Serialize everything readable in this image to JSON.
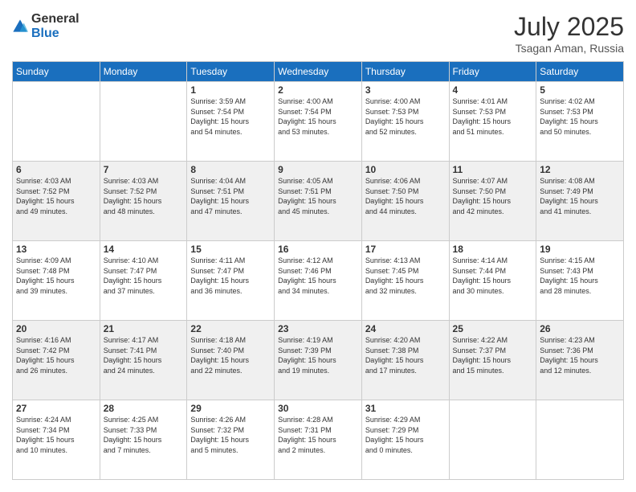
{
  "logo": {
    "general": "General",
    "blue": "Blue"
  },
  "header": {
    "month": "July 2025",
    "location": "Tsagan Aman, Russia"
  },
  "weekdays": [
    "Sunday",
    "Monday",
    "Tuesday",
    "Wednesday",
    "Thursday",
    "Friday",
    "Saturday"
  ],
  "weeks": [
    [
      {
        "day": "",
        "info": ""
      },
      {
        "day": "",
        "info": ""
      },
      {
        "day": "1",
        "info": "Sunrise: 3:59 AM\nSunset: 7:54 PM\nDaylight: 15 hours\nand 54 minutes."
      },
      {
        "day": "2",
        "info": "Sunrise: 4:00 AM\nSunset: 7:54 PM\nDaylight: 15 hours\nand 53 minutes."
      },
      {
        "day": "3",
        "info": "Sunrise: 4:00 AM\nSunset: 7:53 PM\nDaylight: 15 hours\nand 52 minutes."
      },
      {
        "day": "4",
        "info": "Sunrise: 4:01 AM\nSunset: 7:53 PM\nDaylight: 15 hours\nand 51 minutes."
      },
      {
        "day": "5",
        "info": "Sunrise: 4:02 AM\nSunset: 7:53 PM\nDaylight: 15 hours\nand 50 minutes."
      }
    ],
    [
      {
        "day": "6",
        "info": "Sunrise: 4:03 AM\nSunset: 7:52 PM\nDaylight: 15 hours\nand 49 minutes."
      },
      {
        "day": "7",
        "info": "Sunrise: 4:03 AM\nSunset: 7:52 PM\nDaylight: 15 hours\nand 48 minutes."
      },
      {
        "day": "8",
        "info": "Sunrise: 4:04 AM\nSunset: 7:51 PM\nDaylight: 15 hours\nand 47 minutes."
      },
      {
        "day": "9",
        "info": "Sunrise: 4:05 AM\nSunset: 7:51 PM\nDaylight: 15 hours\nand 45 minutes."
      },
      {
        "day": "10",
        "info": "Sunrise: 4:06 AM\nSunset: 7:50 PM\nDaylight: 15 hours\nand 44 minutes."
      },
      {
        "day": "11",
        "info": "Sunrise: 4:07 AM\nSunset: 7:50 PM\nDaylight: 15 hours\nand 42 minutes."
      },
      {
        "day": "12",
        "info": "Sunrise: 4:08 AM\nSunset: 7:49 PM\nDaylight: 15 hours\nand 41 minutes."
      }
    ],
    [
      {
        "day": "13",
        "info": "Sunrise: 4:09 AM\nSunset: 7:48 PM\nDaylight: 15 hours\nand 39 minutes."
      },
      {
        "day": "14",
        "info": "Sunrise: 4:10 AM\nSunset: 7:47 PM\nDaylight: 15 hours\nand 37 minutes."
      },
      {
        "day": "15",
        "info": "Sunrise: 4:11 AM\nSunset: 7:47 PM\nDaylight: 15 hours\nand 36 minutes."
      },
      {
        "day": "16",
        "info": "Sunrise: 4:12 AM\nSunset: 7:46 PM\nDaylight: 15 hours\nand 34 minutes."
      },
      {
        "day": "17",
        "info": "Sunrise: 4:13 AM\nSunset: 7:45 PM\nDaylight: 15 hours\nand 32 minutes."
      },
      {
        "day": "18",
        "info": "Sunrise: 4:14 AM\nSunset: 7:44 PM\nDaylight: 15 hours\nand 30 minutes."
      },
      {
        "day": "19",
        "info": "Sunrise: 4:15 AM\nSunset: 7:43 PM\nDaylight: 15 hours\nand 28 minutes."
      }
    ],
    [
      {
        "day": "20",
        "info": "Sunrise: 4:16 AM\nSunset: 7:42 PM\nDaylight: 15 hours\nand 26 minutes."
      },
      {
        "day": "21",
        "info": "Sunrise: 4:17 AM\nSunset: 7:41 PM\nDaylight: 15 hours\nand 24 minutes."
      },
      {
        "day": "22",
        "info": "Sunrise: 4:18 AM\nSunset: 7:40 PM\nDaylight: 15 hours\nand 22 minutes."
      },
      {
        "day": "23",
        "info": "Sunrise: 4:19 AM\nSunset: 7:39 PM\nDaylight: 15 hours\nand 19 minutes."
      },
      {
        "day": "24",
        "info": "Sunrise: 4:20 AM\nSunset: 7:38 PM\nDaylight: 15 hours\nand 17 minutes."
      },
      {
        "day": "25",
        "info": "Sunrise: 4:22 AM\nSunset: 7:37 PM\nDaylight: 15 hours\nand 15 minutes."
      },
      {
        "day": "26",
        "info": "Sunrise: 4:23 AM\nSunset: 7:36 PM\nDaylight: 15 hours\nand 12 minutes."
      }
    ],
    [
      {
        "day": "27",
        "info": "Sunrise: 4:24 AM\nSunset: 7:34 PM\nDaylight: 15 hours\nand 10 minutes."
      },
      {
        "day": "28",
        "info": "Sunrise: 4:25 AM\nSunset: 7:33 PM\nDaylight: 15 hours\nand 7 minutes."
      },
      {
        "day": "29",
        "info": "Sunrise: 4:26 AM\nSunset: 7:32 PM\nDaylight: 15 hours\nand 5 minutes."
      },
      {
        "day": "30",
        "info": "Sunrise: 4:28 AM\nSunset: 7:31 PM\nDaylight: 15 hours\nand 2 minutes."
      },
      {
        "day": "31",
        "info": "Sunrise: 4:29 AM\nSunset: 7:29 PM\nDaylight: 15 hours\nand 0 minutes."
      },
      {
        "day": "",
        "info": ""
      },
      {
        "day": "",
        "info": ""
      }
    ]
  ]
}
